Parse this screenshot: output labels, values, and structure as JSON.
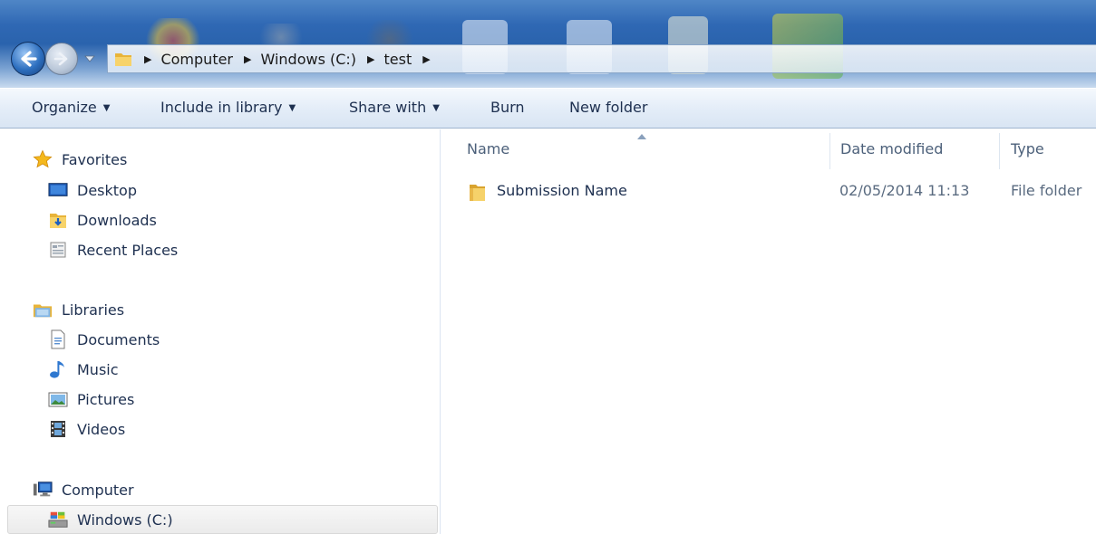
{
  "window": {
    "breadcrumbs": [
      "Computer",
      "Windows (C:)",
      "test"
    ]
  },
  "toolbar": {
    "organize": "Organize",
    "include_in_library": "Include in library",
    "share_with": "Share with",
    "burn": "Burn",
    "new_folder": "New folder"
  },
  "sidebar": {
    "favorites": {
      "label": "Favorites",
      "icon": "star-icon",
      "items": [
        {
          "label": "Desktop",
          "icon": "desktop-icon"
        },
        {
          "label": "Downloads",
          "icon": "downloads-folder-icon"
        },
        {
          "label": "Recent Places",
          "icon": "recent-places-icon"
        }
      ]
    },
    "libraries": {
      "label": "Libraries",
      "icon": "libraries-icon",
      "items": [
        {
          "label": "Documents",
          "icon": "document-icon"
        },
        {
          "label": "Music",
          "icon": "music-note-icon"
        },
        {
          "label": "Pictures",
          "icon": "pictures-icon"
        },
        {
          "label": "Videos",
          "icon": "film-icon"
        }
      ]
    },
    "computer": {
      "label": "Computer",
      "icon": "computer-icon",
      "items": [
        {
          "label": "Windows (C:)",
          "icon": "drive-icon",
          "selected": true
        }
      ]
    }
  },
  "file_list": {
    "columns": [
      "Name",
      "Date modified",
      "Type"
    ],
    "sort_column": "Name",
    "rows": [
      {
        "name": "Submission Name",
        "date_modified": "02/05/2014 11:13",
        "type": "File folder",
        "icon": "folder-icon"
      }
    ]
  },
  "colors": {
    "accent": "#2a63ad",
    "text": "#1e3050",
    "header_text": "#4c607a",
    "muted_text": "#5a6b80",
    "selection": "#ebebeb"
  }
}
